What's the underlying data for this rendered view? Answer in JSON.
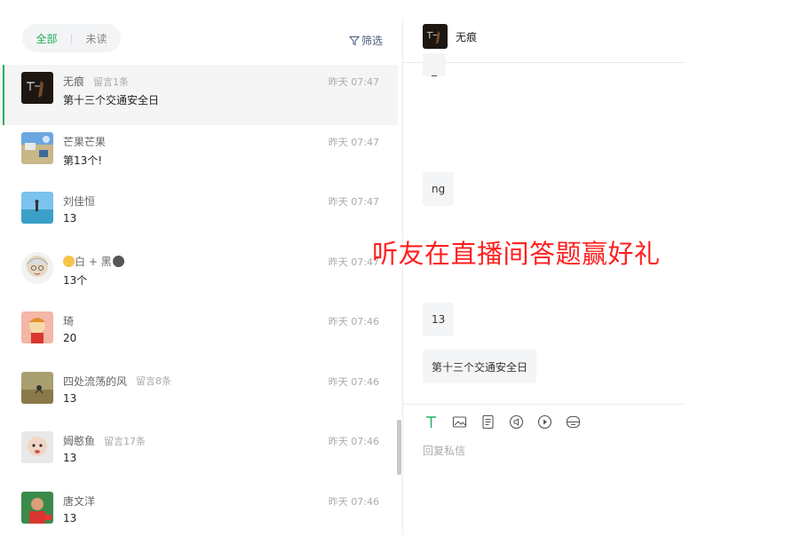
{
  "filters": {
    "all": "全部",
    "unread": "未读",
    "filter_btn": "筛选"
  },
  "conversations": [
    {
      "name": "无痕",
      "msgcount": "留言1条",
      "time": "昨天 07:47",
      "preview": "第十三个交通安全日"
    },
    {
      "name": "芒果芒果",
      "msgcount": "",
      "time": "昨天 07:47",
      "preview": "第13个!"
    },
    {
      "name": "刘佳恒",
      "msgcount": "",
      "time": "昨天 07:47",
      "preview": "13"
    },
    {
      "name_mid": " 白 + 黑",
      "msgcount": "",
      "time": "昨天 07:47",
      "preview": "13个"
    },
    {
      "name": "琦",
      "msgcount": "",
      "time": "昨天 07:46",
      "preview": "20"
    },
    {
      "name": "四处流荡的风",
      "msgcount": "留言8条",
      "time": "昨天 07:46",
      "preview": "13"
    },
    {
      "name": "姆憨鱼",
      "msgcount": "留言17条",
      "time": "昨天 07:46",
      "preview": "13"
    },
    {
      "name": "唐文洋",
      "msgcount": "",
      "time": "昨天 07:46",
      "preview": "13"
    }
  ],
  "chat": {
    "title": "无痕",
    "messages": [
      "_",
      "ng",
      "13",
      "第十三个交通安全日"
    ],
    "reply_placeholder": "回复私信"
  },
  "overlay_caption": "听友在直播间答题赢好礼",
  "colors": {
    "accent": "#20b05a",
    "overlay": "#ff1f1f"
  }
}
